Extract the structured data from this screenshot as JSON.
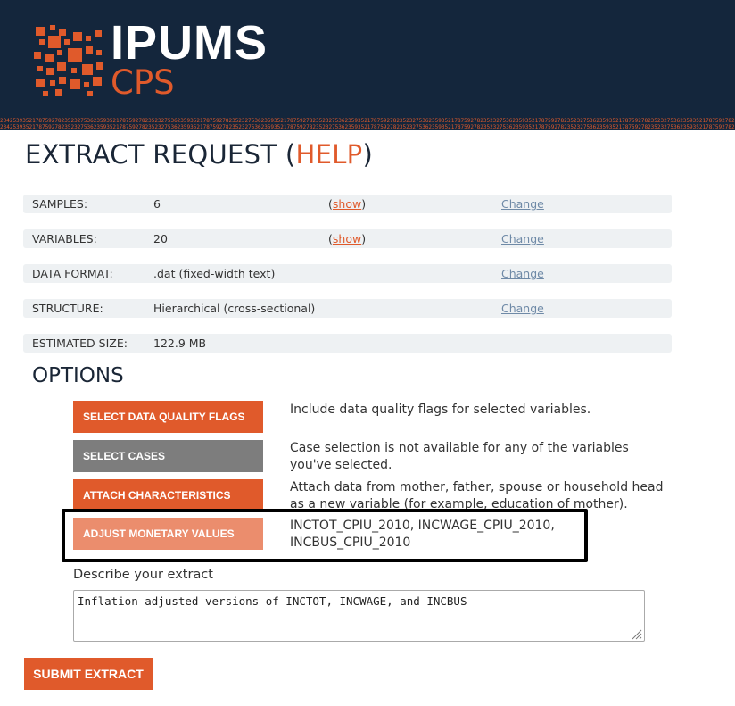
{
  "header": {
    "logo_title": "IPUMS",
    "logo_subtitle": "CPS",
    "digit_band": "23425393521787592782352327536235935217875927823523275362359352178759278235232753623593521787592782352327536235935217875927823523275362359352178759278235232753623593521787592782352327536235935217875927823523275362359352178759278235232753623593521787592782"
  },
  "page": {
    "title_prefix": "EXTRACT REQUEST (",
    "help_label": "HELP",
    "title_suffix": ")"
  },
  "summary": {
    "samples": {
      "label": "SAMPLES:",
      "value": "6",
      "show_open": "(",
      "show_label": "show",
      "show_close": ")",
      "change_label": "Change"
    },
    "variables": {
      "label": "VARIABLES:",
      "value": "20",
      "show_open": "(",
      "show_label": "show",
      "show_close": ")",
      "change_label": "Change"
    },
    "data_format": {
      "label": "DATA FORMAT:",
      "value": ".dat (fixed-width text)",
      "change_label": "Change"
    },
    "structure": {
      "label": "STRUCTURE:",
      "value": "Hierarchical (cross-sectional)",
      "change_label": "Change"
    },
    "estimated_size": {
      "label": "ESTIMATED SIZE:",
      "value": "122.9 MB"
    }
  },
  "options": {
    "title": "OPTIONS",
    "items": [
      {
        "button_label": "SELECT DATA QUALITY FLAGS",
        "description": "Include data quality flags for selected variables.",
        "color": "#e05a2b"
      },
      {
        "button_label": "SELECT CASES",
        "description": "Case selection is not available for any of the variables you've selected.",
        "color": "#7d7d7d"
      },
      {
        "button_label": "ATTACH CHARACTERISTICS",
        "description": "Attach data from mother, father, spouse or household head as a new variable (for example, education of mother).",
        "color": "#e05a2b"
      },
      {
        "button_label": "ADJUST MONETARY VALUES",
        "description": "INCTOT_CPIU_2010, INCWAGE_CPIU_2010, INCBUS_CPIU_2010",
        "color": "#eb8d6d"
      }
    ]
  },
  "describe": {
    "label": "Describe your extract",
    "value": "Inflation-adjusted versions of INCTOT, INCWAGE, and INCBUS"
  },
  "submit": {
    "label": "SUBMIT EXTRACT"
  },
  "colors": {
    "brand_orange": "#e05a2b",
    "header_navy": "#14263c",
    "disabled_gray": "#7d7d7d",
    "link_blue": "#6f8aa7"
  }
}
